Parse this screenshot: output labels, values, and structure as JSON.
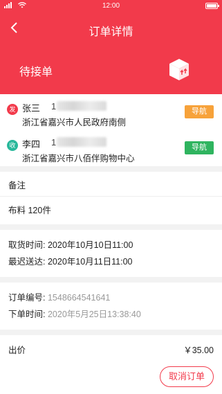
{
  "status_bar": {
    "time": "12:00"
  },
  "nav": {
    "title": "订单详情",
    "back_icon": "chevron-left-icon"
  },
  "hero": {
    "status": "待接单",
    "icon": "package-box-icon"
  },
  "sender": {
    "tag": "发",
    "name": "张三",
    "phone_visible": "1",
    "address": "浙江省嘉兴市人民政府南侧",
    "nav_label": "导航",
    "nav_color": "#f7a23a"
  },
  "receiver": {
    "tag": "收",
    "name": "李四",
    "phone_visible": "1",
    "address": "浙江省嘉兴市八佰伴购物中心",
    "nav_label": "导航",
    "nav_color": "#2fb45f"
  },
  "remark": {
    "title": "备注",
    "content": "布料 120件"
  },
  "times": {
    "pickup_label": "取货时间:",
    "pickup_value": "2020年10月10日11:00",
    "latest_label": "最迟送达:",
    "latest_value": "2020年10月11日11:00"
  },
  "order": {
    "number_label": "订单编号:",
    "number_value": "1548664541641",
    "created_label": "下单时间:",
    "created_value": "2020年5月25日13:38:40"
  },
  "price": {
    "label": "出价",
    "amount": "￥35.00"
  },
  "footer": {
    "cancel_label": "取消订单"
  },
  "colors": {
    "brand": "#f23a4b"
  }
}
